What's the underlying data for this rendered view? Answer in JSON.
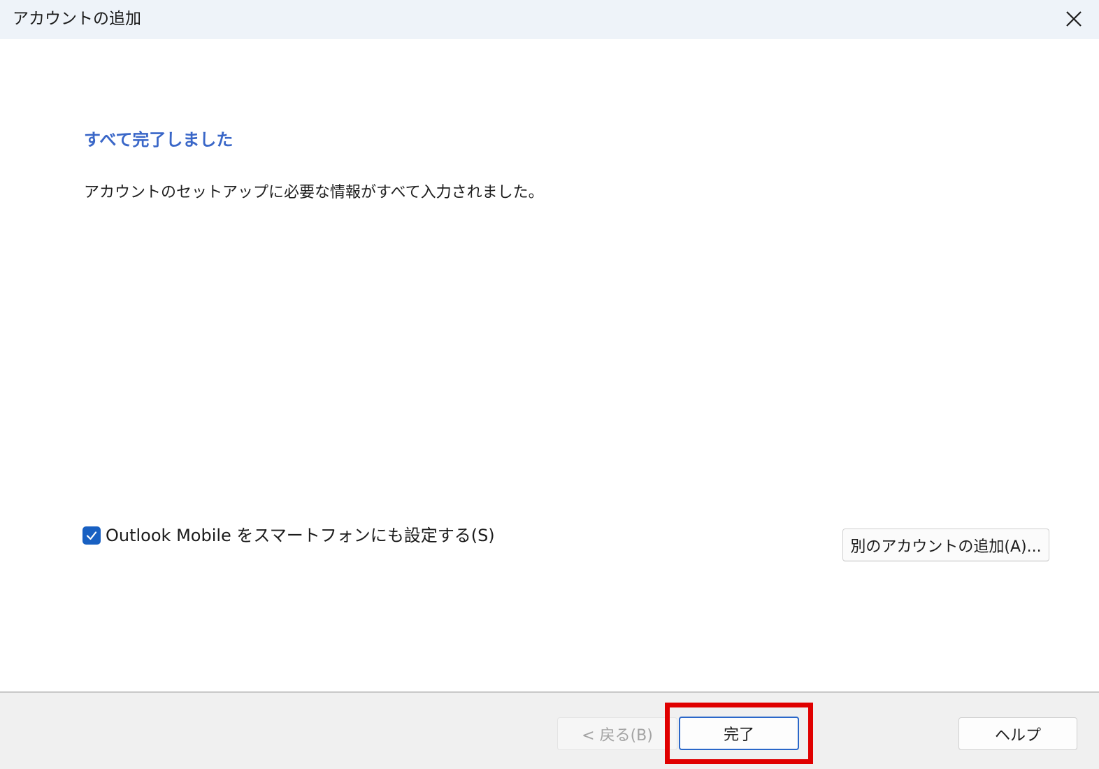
{
  "window": {
    "title": "アカウントの追加"
  },
  "main": {
    "heading": "すべて完了しました",
    "message": "アカウントのセットアップに必要な情報がすべて入力されました。",
    "outlook_mobile_checkbox": {
      "label": "Outlook Mobile をスマートフォンにも設定する(S)",
      "checked": true
    },
    "add_another_account_label": "別のアカウントの追加(A)..."
  },
  "footer": {
    "back_label": "< 戻る(B)",
    "finish_label": "完了",
    "help_label": "ヘルプ"
  },
  "colors": {
    "heading": "#3a67c8",
    "checkbox": "#1860c2",
    "highlight": "#e00000",
    "titlebar": "#eef3f9"
  },
  "icons": {
    "close": "close-icon",
    "check": "checkmark-icon"
  }
}
